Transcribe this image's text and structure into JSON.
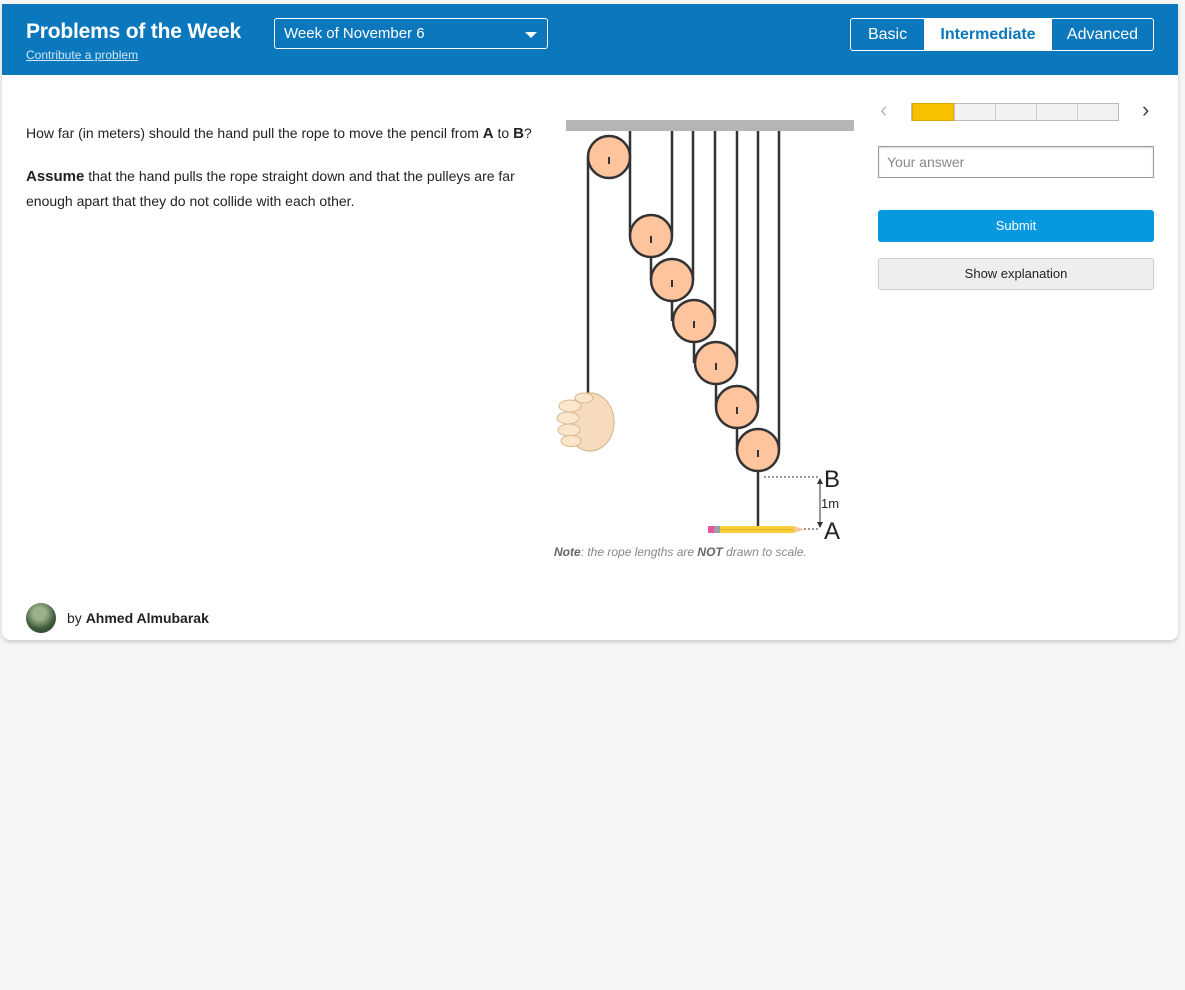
{
  "header": {
    "title": "Problems of the Week",
    "contribute_link": "Contribute a problem",
    "week_select": "Week of November 6",
    "levels": [
      {
        "label": "Basic",
        "active": false
      },
      {
        "label": "Intermediate",
        "active": true
      },
      {
        "label": "Advanced",
        "active": false
      }
    ]
  },
  "problem": {
    "question_pre": "How far (in meters) should the hand pull the rope to move the pencil from ",
    "point_a": "A",
    "question_mid": " to ",
    "point_b": "B",
    "question_end": "?",
    "assume_bold": "Assume",
    "assume_rest": " that the hand pulls the rope straight down and that the pulleys are far enough apart that they do not collide with each other.",
    "figure": {
      "label_b": "B",
      "label_a": "A",
      "distance_label": "1m"
    },
    "note_prefix": "Note",
    "note_mid": ": the rope lengths are ",
    "note_emph": "NOT",
    "note_end": " drawn to scale."
  },
  "author": {
    "by": "by ",
    "name": "Ahmed Almubarak"
  },
  "answer_panel": {
    "prev_icon": "chevron-left-icon",
    "next_icon": "chevron-right-icon",
    "progress_total": 5,
    "progress_current": 1,
    "input_placeholder": "Your answer",
    "submit_label": "Submit",
    "explain_label": "Show explanation"
  },
  "colors": {
    "header_bg": "#0b78bd",
    "submit_bg": "#0798e0",
    "progress_fill": "#f8c100",
    "pulley_fill": "#fdc49e"
  }
}
